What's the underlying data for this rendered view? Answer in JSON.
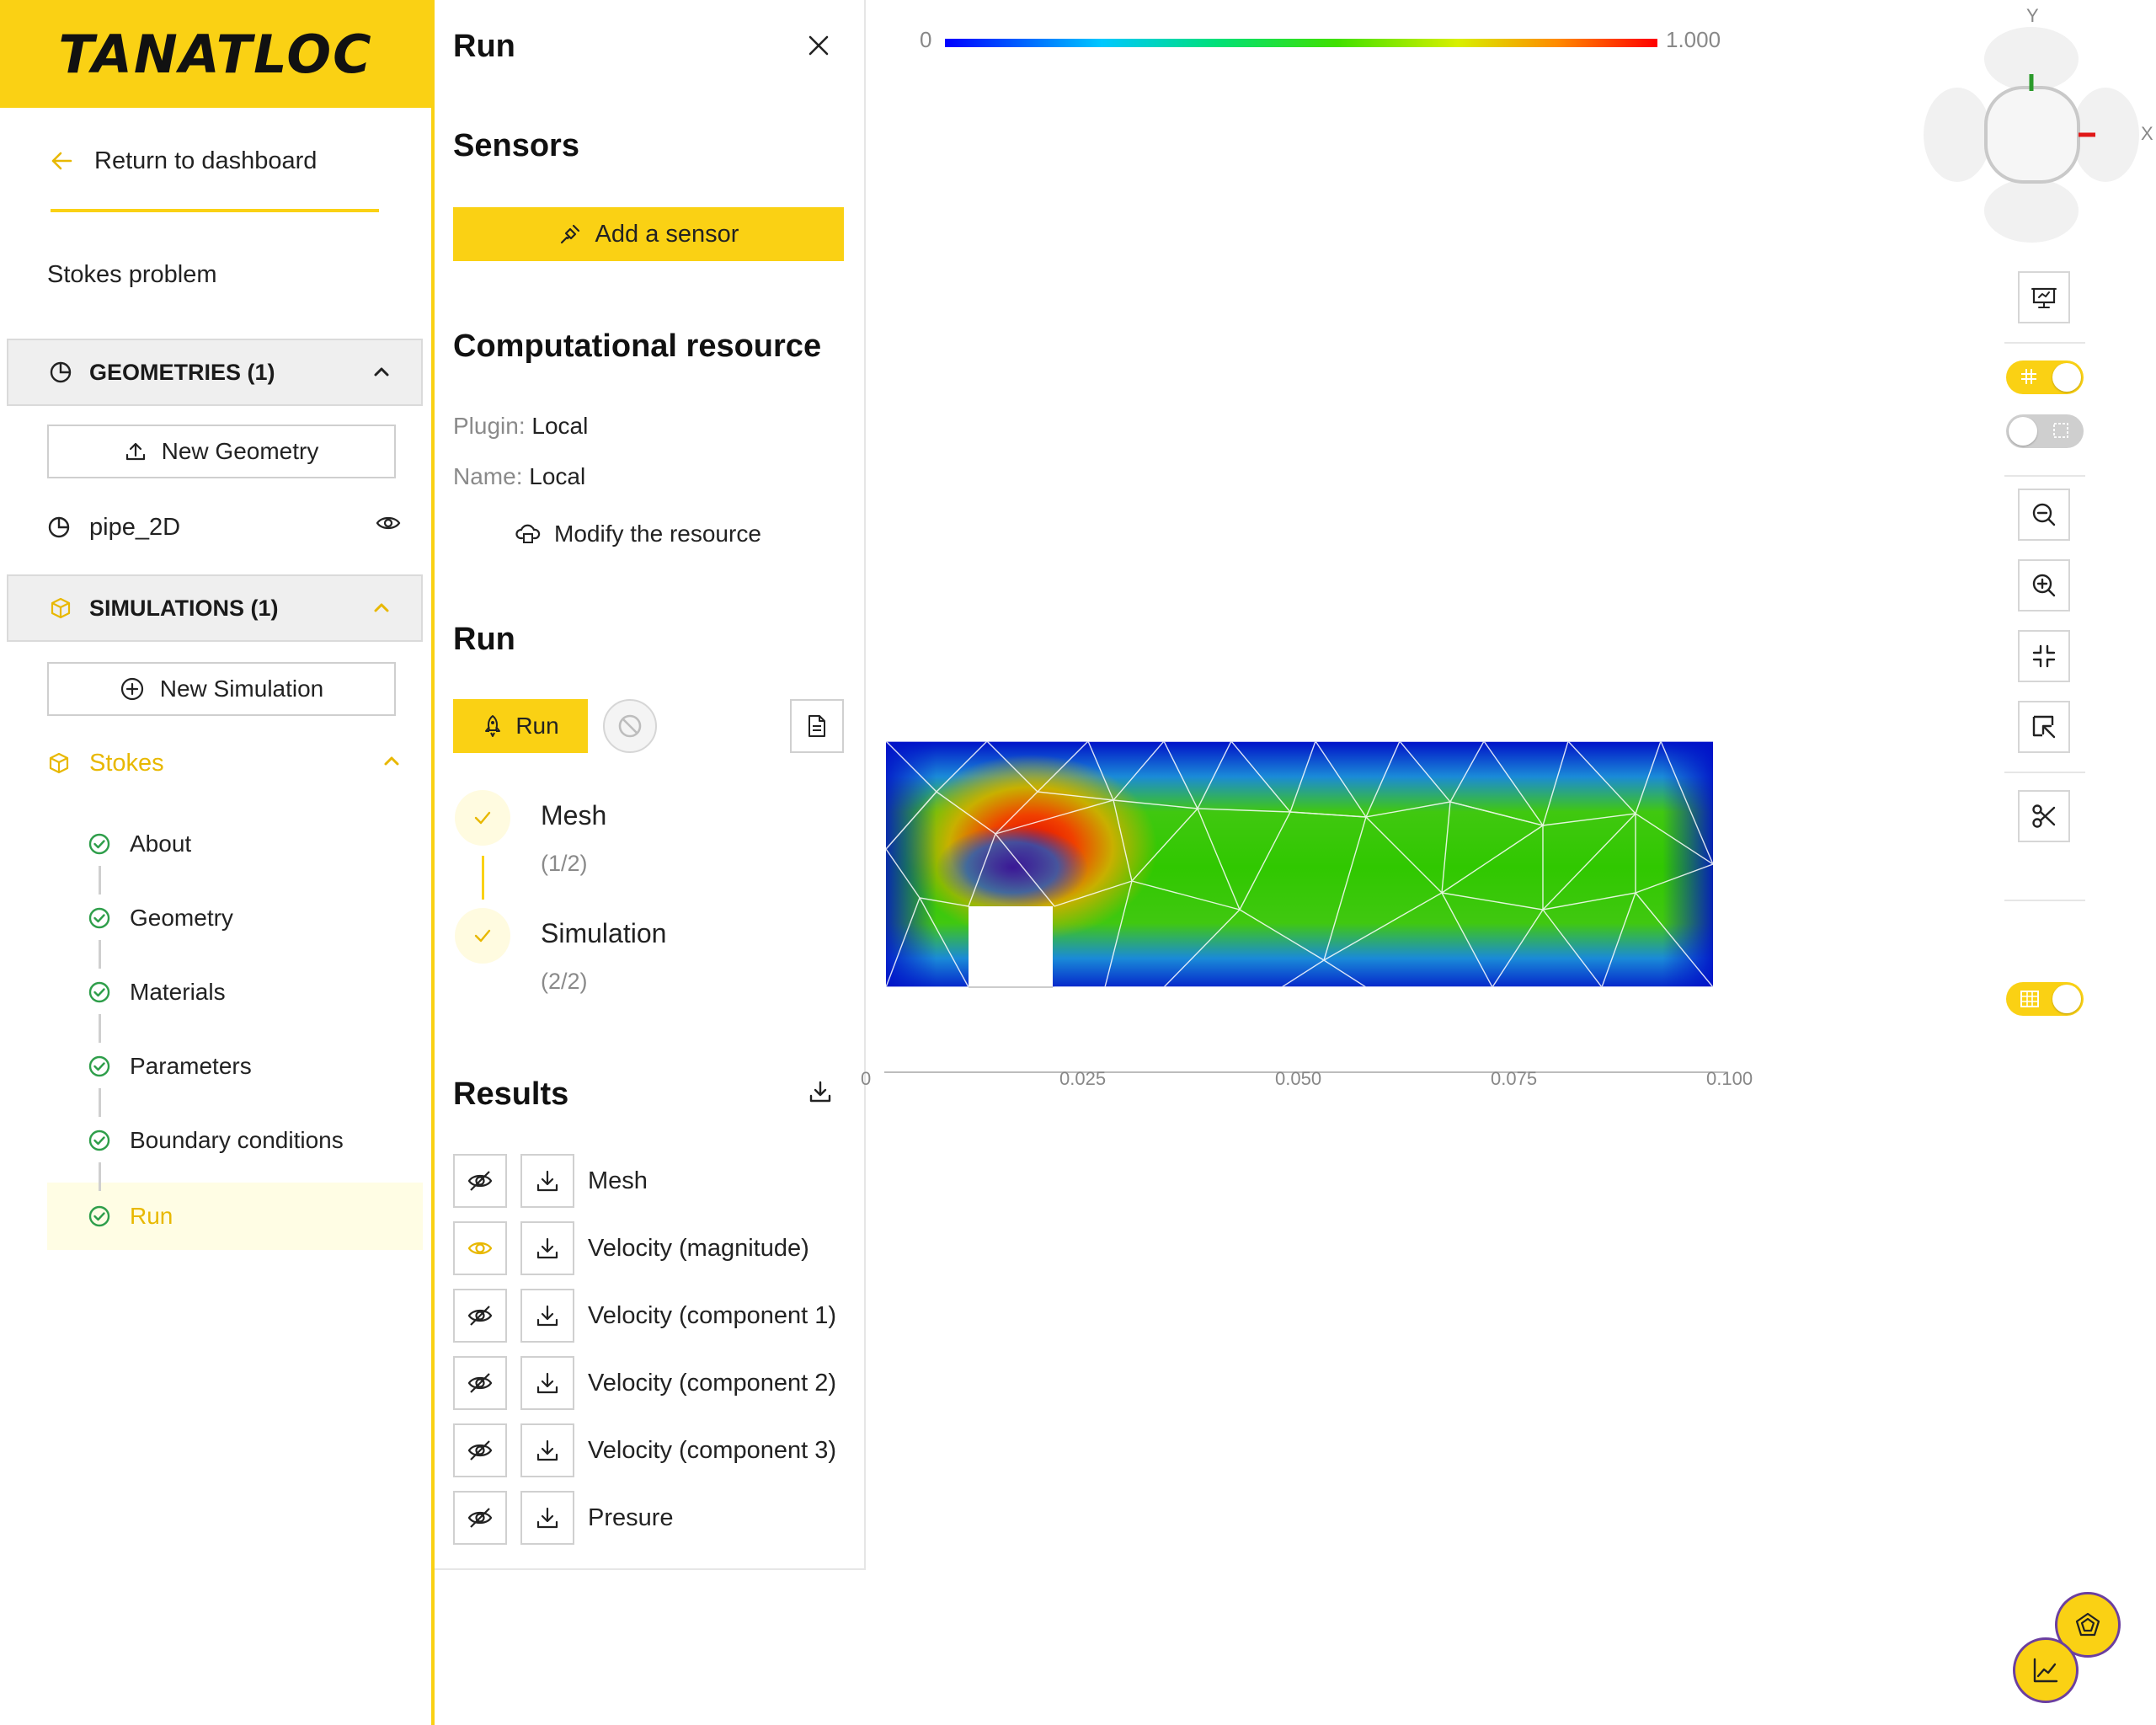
{
  "brand": {
    "logo": "TANATLOC",
    "accent": "#fad114"
  },
  "sidebar": {
    "return_label": "Return to dashboard",
    "project_name": "Stokes problem",
    "geometries": {
      "header": "GEOMETRIES (1)",
      "new_button": "New Geometry",
      "items": [
        {
          "name": "pipe_2D",
          "visible": true
        }
      ]
    },
    "simulations": {
      "header": "SIMULATIONS (1)",
      "new_button": "New Simulation",
      "current": "Stokes",
      "steps": [
        {
          "label": "About",
          "status": "done"
        },
        {
          "label": "Geometry",
          "status": "done"
        },
        {
          "label": "Materials",
          "status": "done"
        },
        {
          "label": "Parameters",
          "status": "done"
        },
        {
          "label": "Boundary conditions",
          "status": "done"
        },
        {
          "label": "Run",
          "status": "active"
        }
      ]
    }
  },
  "panel": {
    "title": "Run",
    "sensors": {
      "title": "Sensors",
      "add_button": "Add a sensor"
    },
    "resource": {
      "title": "Computational resource",
      "plugin_key": "Plugin:",
      "plugin_value": "Local",
      "name_key": "Name:",
      "name_value": "Local",
      "modify_label": "Modify the resource"
    },
    "run": {
      "title": "Run",
      "run_button": "Run",
      "tasks": [
        {
          "label": "Mesh",
          "progress": "(1/2)"
        },
        {
          "label": "Simulation",
          "progress": "(2/2)"
        }
      ]
    },
    "results": {
      "title": "Results",
      "items": [
        {
          "label": "Mesh",
          "visible": false
        },
        {
          "label": "Velocity (magnitude)",
          "visible": true
        },
        {
          "label": "Velocity (component 1)",
          "visible": false
        },
        {
          "label": "Velocity (component 2)",
          "visible": false
        },
        {
          "label": "Velocity (component 3)",
          "visible": false
        },
        {
          "label": "Presure",
          "visible": false
        }
      ]
    }
  },
  "viewport": {
    "colorbar": {
      "min": "0",
      "max": "1.000"
    },
    "axis_ticks": [
      "0",
      "0.025",
      "0.050",
      "0.075",
      "0.100"
    ],
    "navcube": {
      "y_label": "Y",
      "x_label": "X"
    },
    "toggles": {
      "grid": true,
      "dimensions": false,
      "table": true
    }
  }
}
